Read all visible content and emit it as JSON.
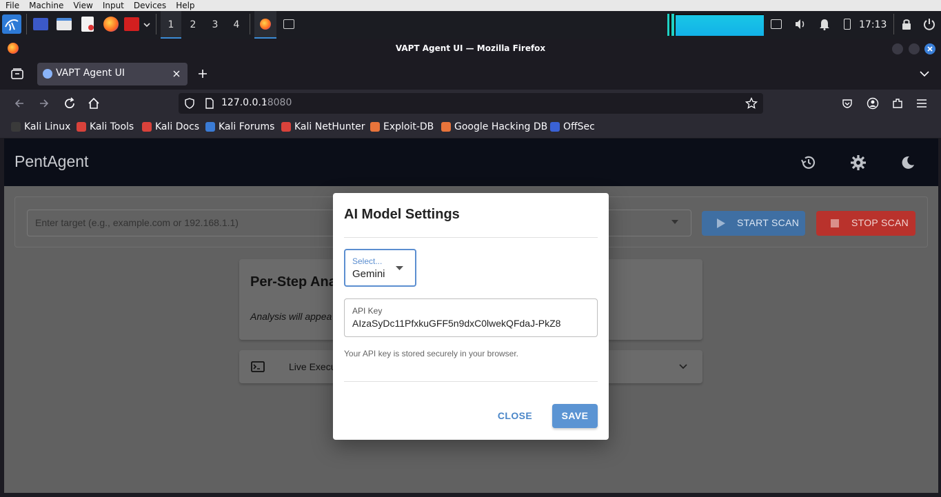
{
  "vm_menu": [
    "File",
    "Machine",
    "View",
    "Input",
    "Devices",
    "Help"
  ],
  "panel": {
    "workspaces": [
      "1",
      "2",
      "3",
      "4"
    ],
    "clock": "17:13"
  },
  "browser": {
    "window_title": "VAPT Agent UI — Mozilla Firefox",
    "tab_title": "VAPT Agent UI",
    "url_host": "127.0.0.1",
    "url_port": ":8080",
    "bookmarks": [
      "Kali Linux",
      "Kali Tools",
      "Kali Docs",
      "Kali Forums",
      "Kali NetHunter",
      "Exploit-DB",
      "Google Hacking DB",
      "OffSec"
    ]
  },
  "app": {
    "brand": "PentAgent",
    "target_placeholder": "Enter target (e.g., example.com or 192.168.1.1)",
    "start_scan": "START SCAN",
    "stop_scan": "STOP SCAN",
    "analysis_title": "Per-Step Ana",
    "analysis_placeholder": "Analysis will appea",
    "live_execution": "Live Execu"
  },
  "dialog": {
    "title": "AI Model Settings",
    "select_label": "Select...",
    "select_value": "Gemini",
    "api_key_label": "API Key",
    "api_key_value": "AIzaSyDc11PfxkuGFF5n9dxC0lwekQFdaJ-PkZ8",
    "helper": "Your API key is stored securely in your browser.",
    "close": "CLOSE",
    "save": "SAVE"
  },
  "colors": {
    "app_bar": "#0b0e18",
    "start_button": "#3f6fa3",
    "stop_button": "#b9322c",
    "dialog_accent": "#5b94d3"
  }
}
